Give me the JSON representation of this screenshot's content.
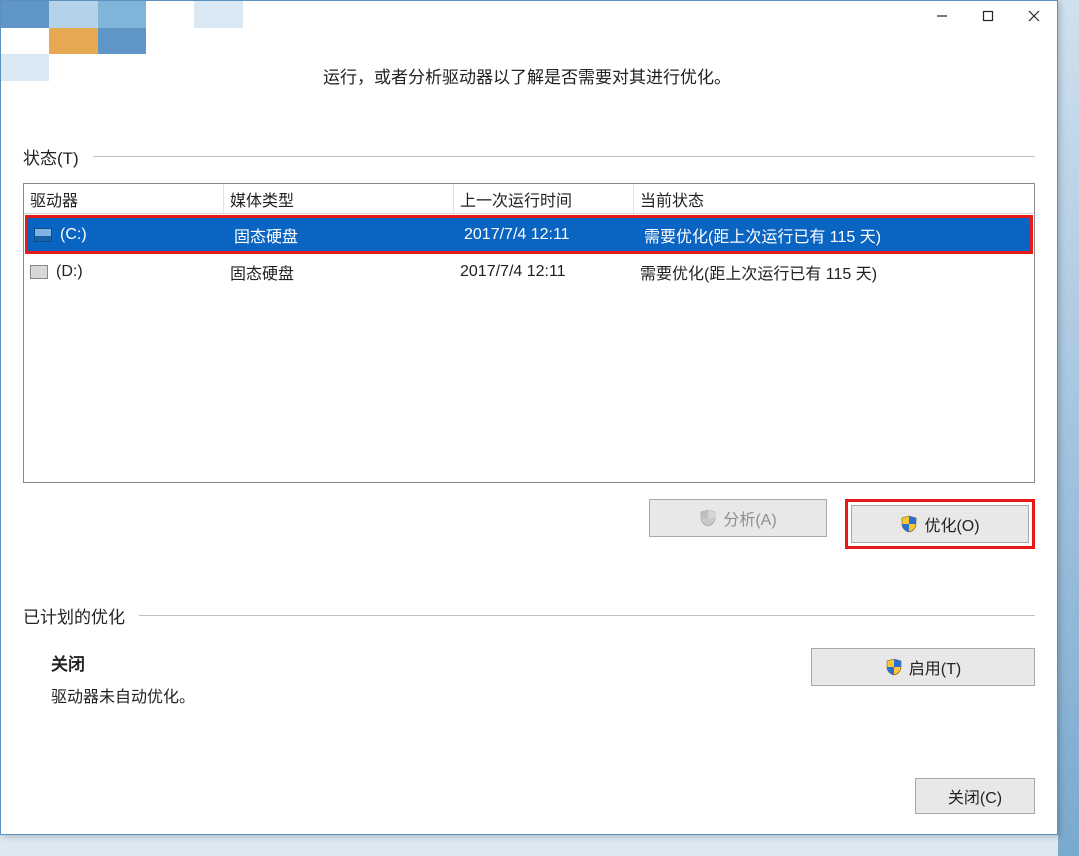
{
  "intro_fragment": "运行，或者分析驱动器以了解是否需要对其进行优化。",
  "sections": {
    "status_label": "状态(T)",
    "scheduled_label": "已计划的优化"
  },
  "table": {
    "headers": {
      "drive": "驱动器",
      "media": "媒体类型",
      "last_run": "上一次运行时间",
      "status": "当前状态"
    },
    "rows": [
      {
        "name": "(C:)",
        "media": "固态硬盘",
        "last_run": "2017/7/4 12:11",
        "status": "需要优化(距上次运行已有 115 天)",
        "selected": true,
        "icon": "c"
      },
      {
        "name": "(D:)",
        "media": "固态硬盘",
        "last_run": "2017/7/4 12:11",
        "status": "需要优化(距上次运行已有 115 天)",
        "selected": false,
        "icon": "d"
      }
    ]
  },
  "buttons": {
    "analyze": "分析(A)",
    "optimize": "优化(O)",
    "enable": "启用(T)",
    "close": "关闭(C)"
  },
  "scheduled": {
    "off_label": "关闭",
    "off_desc": "驱动器未自动优化。"
  }
}
